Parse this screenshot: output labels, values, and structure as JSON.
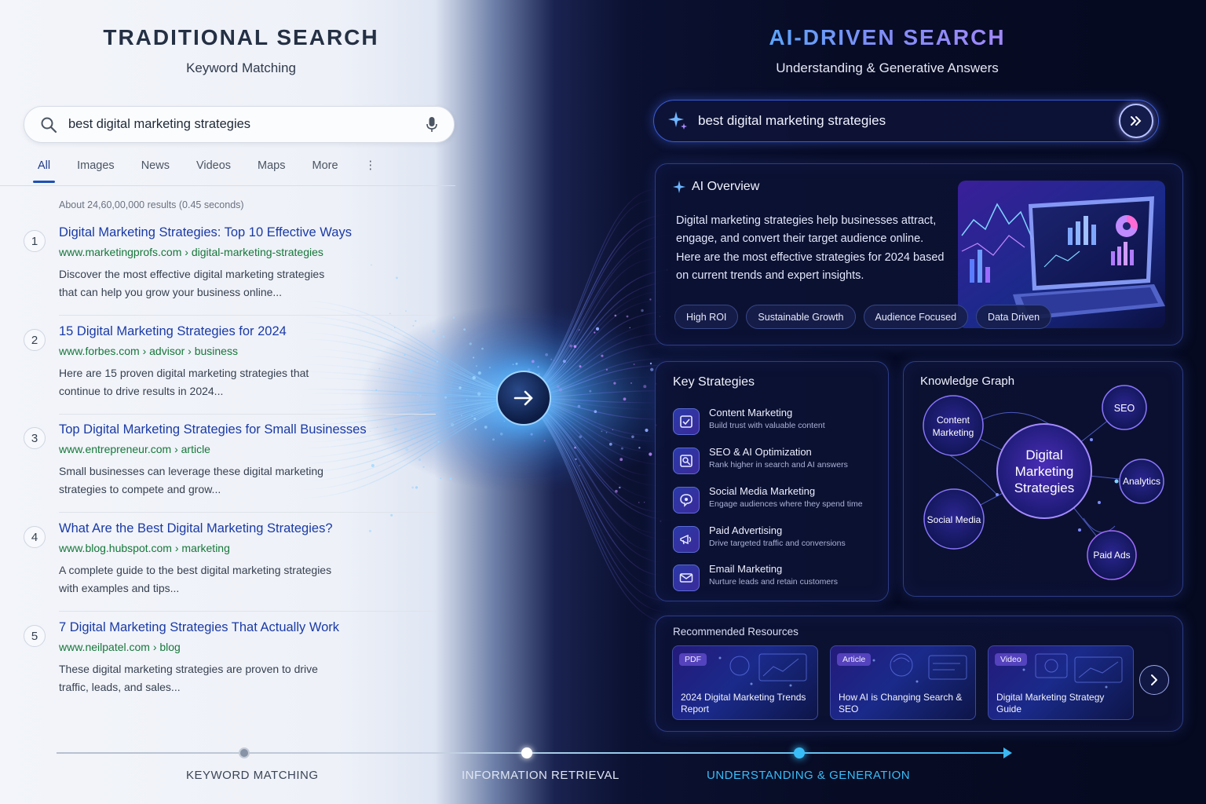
{
  "left": {
    "title": "TRADITIONAL SEARCH",
    "subtitle": "Keyword Matching",
    "search_query": "best digital marketing strategies",
    "tabs": [
      "All",
      "Images",
      "News",
      "Videos",
      "Maps",
      "More"
    ],
    "active_tab": "All",
    "stats": "About 24,60,00,000 results (0.45 seconds)",
    "results": [
      {
        "num": "1",
        "title": "Digital Marketing Strategies: Top 10 Effective Ways",
        "url": "www.marketingprofs.com › digital-marketing-strategies",
        "snippet": "Discover the most effective digital marketing strategies that can help you grow your business online..."
      },
      {
        "num": "2",
        "title": "15 Digital Marketing Strategies for 2024",
        "url": "www.forbes.com › advisor › business",
        "snippet": "Here are 15 proven digital marketing strategies that continue to drive results in 2024..."
      },
      {
        "num": "3",
        "title": "Top Digital Marketing Strategies for Small Businesses",
        "url": "www.entrepreneur.com › article",
        "snippet": "Small businesses can leverage these digital marketing strategies to compete and grow..."
      },
      {
        "num": "4",
        "title": "What Are the Best Digital Marketing Strategies?",
        "url": "www.blog.hubspot.com › marketing",
        "snippet": "A complete guide to the best digital marketing strategies with examples and tips..."
      },
      {
        "num": "5",
        "title": "7 Digital Marketing Strategies That Actually Work",
        "url": "www.neilpatel.com › blog",
        "snippet": "These digital marketing strategies are proven to drive traffic, leads, and sales..."
      }
    ]
  },
  "right": {
    "title": "AI-DRIVEN SEARCH",
    "subtitle": "Understanding & Generative Answers",
    "search_query": "best digital marketing strategies",
    "overview": {
      "heading": "AI Overview",
      "text": "Digital marketing strategies help businesses attract, engage, and convert their target audience online. Here are the most effective strategies for 2024 based on current trends and expert insights.",
      "chips": [
        "High ROI",
        "Sustainable Growth",
        "Audience Focused",
        "Data Driven"
      ]
    },
    "key_strategies": {
      "heading": "Key Strategies",
      "items": [
        {
          "title": "Content Marketing",
          "desc": "Build trust with valuable content",
          "icon": "content-icon"
        },
        {
          "title": "SEO & AI Optimization",
          "desc": "Rank higher in search and AI answers",
          "icon": "seo-icon"
        },
        {
          "title": "Social Media Marketing",
          "desc": "Engage audiences where they spend time",
          "icon": "social-icon"
        },
        {
          "title": "Paid Advertising",
          "desc": "Drive targeted traffic and conversions",
          "icon": "ads-icon"
        },
        {
          "title": "Email Marketing",
          "desc": "Nurture leads and retain customers",
          "icon": "email-icon"
        }
      ]
    },
    "knowledge_graph": {
      "heading": "Knowledge Graph",
      "center": [
        "Digital",
        "Marketing",
        "Strategies"
      ],
      "nodes": {
        "content": [
          "Content",
          "Marketing"
        ],
        "seo": "SEO",
        "analytics": "Analytics",
        "social": "Social Media",
        "paid": "Paid Ads"
      }
    },
    "resources": {
      "heading": "Recommended Resources",
      "items": [
        {
          "tag": "PDF",
          "title": "2024 Digital Marketing Trends Report"
        },
        {
          "tag": "Article",
          "title": "How AI is Changing Search & SEO"
        },
        {
          "tag": "Video",
          "title": "Digital Marketing Strategy Guide"
        }
      ]
    }
  },
  "timeline": {
    "stages": [
      "KEYWORD MATCHING",
      "INFORMATION RETRIEVAL",
      "UNDERSTANDING & GENERATION"
    ]
  },
  "colors": {
    "link_blue": "#1a3aa6",
    "url_green": "#16773a",
    "accent_cyan": "#38bdf8",
    "accent_violet": "#a78bfa"
  }
}
